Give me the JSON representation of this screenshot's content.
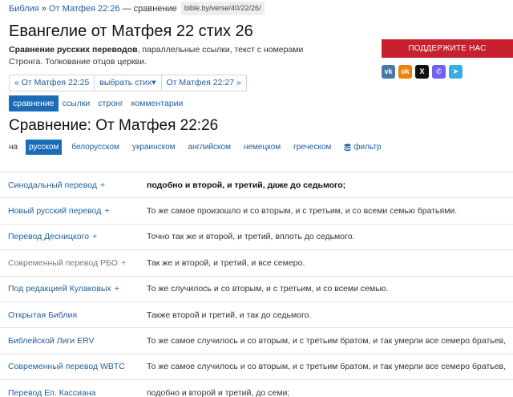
{
  "breadcrumbs": {
    "root": "Библия",
    "sep": "»",
    "current": "От Матфея 22:26",
    "suffix": "— сравнение"
  },
  "url": "bible.by/verse/40/22/26/",
  "title": "Евангелие от Матфея 22 стих 26",
  "intro": {
    "bold": "Сравнение русских переводов",
    "rest": ", параллельные ссылки, текст с номерами Стронга. Толкование отцов церкви."
  },
  "donate_label": "ПОДДЕРЖИТЕ НАС",
  "socials": [
    {
      "icon": "vk-icon",
      "glyph": "vk",
      "color": "#4a76a8"
    },
    {
      "icon": "ok-icon",
      "glyph": "ok",
      "color": "#ee8208"
    },
    {
      "icon": "x-icon",
      "glyph": "X",
      "color": "#111111"
    },
    {
      "icon": "viber-icon",
      "glyph": "✆",
      "color": "#7360f2"
    },
    {
      "icon": "telegram-icon",
      "glyph": "➤",
      "color": "#37aee2"
    }
  ],
  "pager": {
    "prev": "« От Матфея 22:25",
    "select": "выбрать стих▾",
    "next": "От Матфея 22:27 »"
  },
  "tabs": [
    "сравнение",
    "ссылки",
    "стронг",
    "комментарии"
  ],
  "section_title": "Сравнение: От Матфея 22:26",
  "langs": {
    "prefix": "на",
    "items": [
      "русском",
      "белорусском",
      "украинском",
      "английском",
      "немецком",
      "греческом"
    ],
    "filter": "фильтр"
  },
  "rows": [
    {
      "name": "Синодальный перевод",
      "plus": "+",
      "text": "подобно и второй, и третий, даже до седьмого;",
      "bold": true,
      "grey": false
    },
    {
      "name": "Новый русский перевод",
      "plus": "+",
      "text": "То же самое произошло и со вторым, и с третьим, и со всеми семью братьями.",
      "bold": false,
      "grey": false
    },
    {
      "name": "Перевод Десницкого",
      "plus": "+",
      "text": "Точно так же и второй, и третий, вплоть до седьмого.",
      "bold": false,
      "grey": false
    },
    {
      "name": "Современный перевод РБО",
      "plus": "+",
      "text": "Так же и второй, и третий, и все семеро.",
      "bold": false,
      "grey": true
    },
    {
      "name": "Под редакцией Кулаковых",
      "plus": "+",
      "text": "То же случилось и со вторым, и с третьим, и со всеми семью.",
      "bold": false,
      "grey": false
    },
    {
      "name": "Открытая Библия",
      "plus": "",
      "text": "Также второй и третий, и так до седьмого.",
      "bold": false,
      "grey": false
    },
    {
      "name": "Библейской Лиги ERV",
      "plus": "",
      "text": "То же самое случилось и со вторым, и с третьим братом, и так умерли все семеро братьев,",
      "bold": false,
      "grey": false
    },
    {
      "name": "Современный перевод WBTC",
      "plus": "",
      "text": "То же самое случилось и со вторым, и с третьим братом, и так умерли все семеро братьев,",
      "bold": false,
      "grey": false
    },
    {
      "name": "Перевод Еп. Кассиана",
      "plus": "",
      "text": "подобно и второй и третий, до семи;",
      "bold": false,
      "grey": false
    }
  ]
}
